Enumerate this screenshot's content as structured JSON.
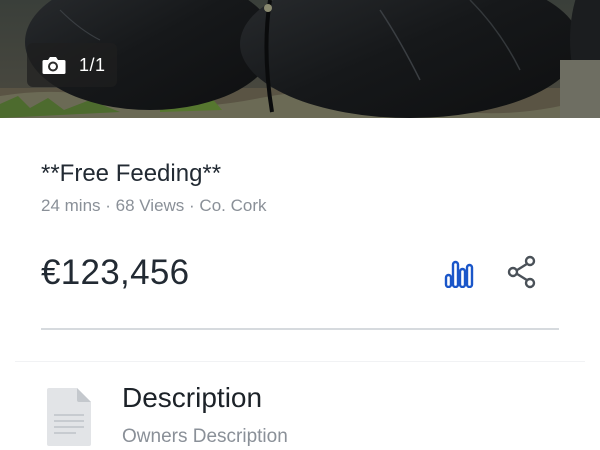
{
  "photo": {
    "counter": "1/1",
    "camera_icon": "camera-icon"
  },
  "listing": {
    "title": "**Free Feeding**",
    "meta": "24 mins · 68 Views · Co. Cork",
    "price": "€123,456"
  },
  "actions": {
    "stats_icon": "bar-chart-icon",
    "share_icon": "share-icon"
  },
  "description": {
    "heading": "Description",
    "subtitle": "Owners Description",
    "icon": "document-icon"
  },
  "colors": {
    "accent": "#1a56c9",
    "icon_gray": "#4a5158",
    "text_dark": "#222a33",
    "text_muted": "#8a9098"
  }
}
